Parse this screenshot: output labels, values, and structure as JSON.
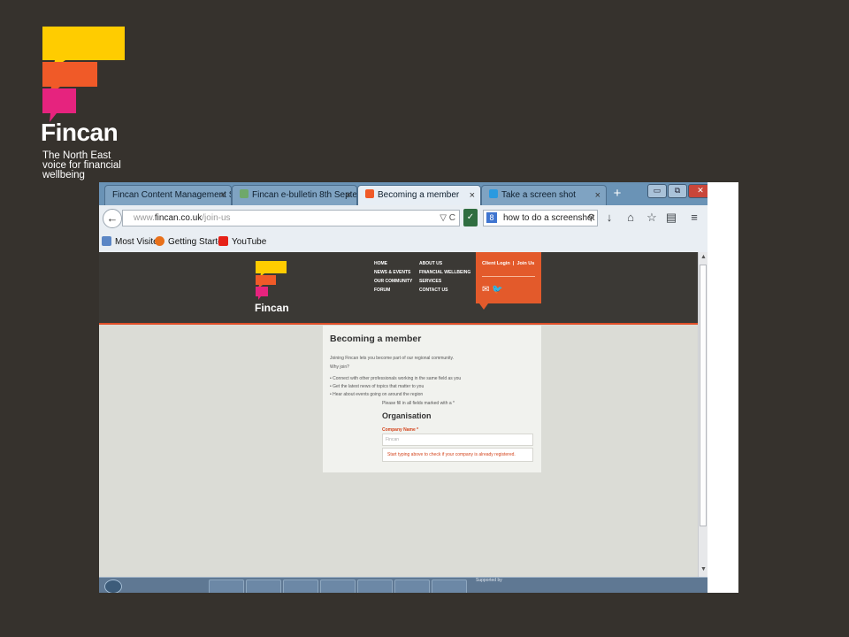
{
  "slide": {
    "logo_word": "Fincan",
    "tagline": [
      "The North East",
      "voice for financial",
      "wellbeing"
    ],
    "brand_colors": {
      "yellow": "#ffcc00",
      "orange": "#f05a28",
      "pink": "#e6237e"
    }
  },
  "browser": {
    "tabs": [
      {
        "label": "Fincan Content Management S...",
        "close": "×",
        "active": false
      },
      {
        "label": "Fincan e-bulletin 8th Septe...",
        "close": "×",
        "active": false
      },
      {
        "label": "Becoming a member",
        "close": "×",
        "active": true
      },
      {
        "label": "Take a screen shot",
        "close": "×",
        "active": false
      }
    ],
    "new_tab_icon": "+",
    "window_controls": {
      "minimize": "▭",
      "restore": "⧉",
      "close": "✕"
    },
    "url": {
      "prefix": "www.",
      "host": "fincan.co.uk",
      "path": "/join-us"
    },
    "url_controls": "▽ C",
    "search": {
      "engine_icon": "8",
      "dropdown": "▾",
      "value": "how to do a screenshot",
      "icon": "⚲"
    },
    "nav_icons": [
      "↓",
      "⌂",
      "☆",
      "▤",
      "≡"
    ],
    "bookmarks": [
      {
        "label": "Most Visited",
        "icon": "bookmark-folder-icon",
        "color": "#5b86c5"
      },
      {
        "label": "Getting Started",
        "icon": "firefox-icon",
        "color": "#e8701a"
      },
      {
        "label": "YouTube",
        "icon": "youtube-icon",
        "color": "#e62117"
      }
    ]
  },
  "site": {
    "logo_word": "Fincan",
    "menu_col1": [
      "Home",
      "News & Events",
      "Our Community",
      "Forum"
    ],
    "menu_col2": [
      "About Us",
      "Financial Wellbeing",
      "Services",
      "Contact Us"
    ],
    "login": {
      "client_login": "Client Login",
      "separator": "|",
      "join_us": "Join Us",
      "icons": "✉ 🐦"
    },
    "page": {
      "title": "Becoming a member",
      "intro": "Joining Fincan lets you become part of our regional community.",
      "why": "Why join?",
      "bullets": [
        "Connect with other professionals working in the same field as you",
        "Get the latest news of topics that matter to you",
        "Hear about events going on around the region"
      ],
      "required_note": "Please fill in all fields marked with a *",
      "section": "Organisation",
      "company_label": "Company Name *",
      "company_placeholder": "Fincan",
      "company_hint": "Start typing above to check if your company is already registered."
    }
  },
  "taskbar": {
    "text": "Supported by"
  }
}
